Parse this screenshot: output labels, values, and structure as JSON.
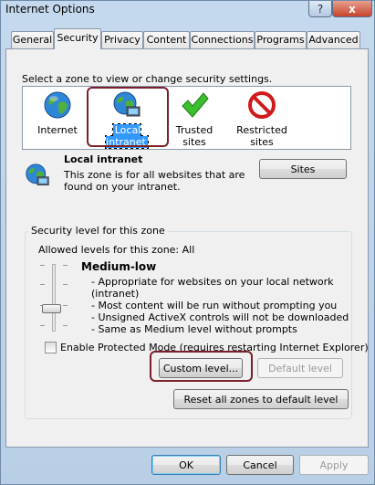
{
  "window": {
    "title": "Internet Options",
    "help_glyph": "?",
    "close_glyph": "x"
  },
  "tabs": [
    {
      "label": "General"
    },
    {
      "label": "Security"
    },
    {
      "label": "Privacy"
    },
    {
      "label": "Content"
    },
    {
      "label": "Connections"
    },
    {
      "label": "Programs"
    },
    {
      "label": "Advanced"
    }
  ],
  "active_tab": "Security",
  "zone_prompt": "Select a zone to view or change security settings.",
  "zones": [
    {
      "label": "Internet",
      "icon": "globe-icon"
    },
    {
      "label": "Local intranet",
      "icon": "intranet-globe-icon",
      "selected": true
    },
    {
      "label": "Trusted sites",
      "icon": "green-check-icon"
    },
    {
      "label": "Restricted sites",
      "icon": "no-entry-icon"
    }
  ],
  "zone_detail": {
    "title": "Local intranet",
    "description": "This zone is for all websites that are found on your intranet.",
    "sites_button": "Sites"
  },
  "security_level": {
    "group_title": "Security level for this zone",
    "allowed": "Allowed levels for this zone: All",
    "level_name": "Medium-low",
    "bullets": [
      "- Appropriate for websites on your local network",
      "(intranet)",
      "- Most content will be run without prompting you",
      "- Unsigned ActiveX controls will not be downloaded",
      "- Same as Medium level without prompts"
    ],
    "protected_mode_label": "Enable Protected Mode (requires restarting Internet Explorer)",
    "protected_mode_checked": false,
    "custom_level_button": "Custom level...",
    "default_level_button": "Default level"
  },
  "reset_all_button": "Reset all zones to default level",
  "footer": {
    "ok": "OK",
    "cancel": "Cancel",
    "apply": "Apply"
  },
  "colors": {
    "selection": "#3399ff",
    "highlight_frame": "#7a1f2b"
  }
}
